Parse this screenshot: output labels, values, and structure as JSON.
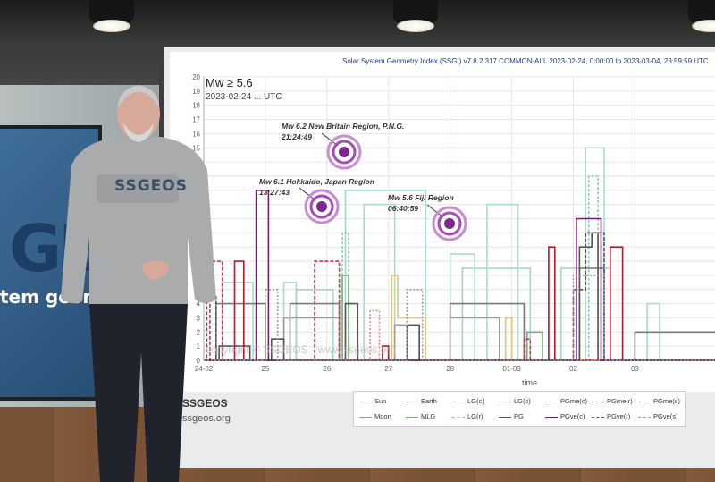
{
  "chart_data": {
    "type": "line",
    "title": "Solar System Geometry Index (SSGI) v7.8.2.317 COMMON-ALL 2023-02-24, 0:00:00 to 2023-03-04, 23:59:59 UTC",
    "subtitle": "Mw ≥ 5.6",
    "date_label": "2023-02-24 ... UTC",
    "xlabel": "time",
    "ylabel": "",
    "x_ticks": [
      "24-02",
      "25",
      "26",
      "27",
      "28",
      "01-03",
      "02",
      "03"
    ],
    "y_ticks": [
      0,
      1,
      2,
      3,
      4,
      5,
      6,
      7,
      8,
      9,
      10,
      11,
      12,
      13,
      14,
      15,
      16,
      17,
      18,
      19,
      20
    ],
    "ylim": [
      0,
      20
    ],
    "xlim": [
      0,
      8.3
    ],
    "grid": true,
    "series": [
      {
        "name": "LG(s)",
        "color": "#a9dccb",
        "dash": "",
        "x": [
          0,
          0.3,
          0.3,
          0.8,
          0.8,
          1.3,
          1.3,
          1.5,
          1.5,
          2.6,
          2.6,
          3.1,
          3.1,
          4.0,
          4.0,
          4.4,
          4.4,
          4.6,
          4.6,
          5.1,
          5.1,
          6.2,
          6.2,
          6.5,
          6.5,
          7.2,
          7.2,
          7.4,
          7.4,
          8.3
        ],
        "y": [
          0,
          0,
          5.5,
          5.5,
          0,
          0,
          5.5,
          5.5,
          0,
          0,
          11,
          11,
          0,
          0,
          7.5,
          7.5,
          0,
          0,
          11,
          11,
          0,
          0,
          15,
          15,
          0,
          0,
          4,
          4,
          0,
          0
        ]
      },
      {
        "name": "LG(c)",
        "color": "#9fd6c4",
        "dash": "",
        "x": [
          0,
          1.5,
          1.5,
          2.1,
          2.1,
          2.3,
          2.3,
          3.6,
          3.6,
          4.2,
          4.2,
          5.3,
          5.3,
          5.8,
          5.8,
          6.6,
          6.6,
          8.3
        ],
        "y": [
          0,
          0,
          5,
          5,
          0,
          0,
          12,
          12,
          0,
          0,
          6.5,
          6.5,
          0,
          0,
          6.5,
          6.5,
          0,
          0
        ]
      },
      {
        "name": "LG(r)",
        "color": "#8cc9b5",
        "dash": "3,2",
        "x": [
          0,
          2.25,
          2.25,
          2.35,
          2.35,
          6.25,
          6.25,
          6.4,
          6.4,
          8.3
        ],
        "y": [
          0,
          0,
          9,
          9,
          0,
          0,
          13,
          13,
          0,
          0
        ]
      },
      {
        "name": "Sun",
        "color": "#e3c46c",
        "dash": "",
        "x": [
          0,
          3.05,
          3.05,
          3.15,
          3.15,
          3.6,
          3.6,
          4.9,
          4.9,
          5.0,
          5.0,
          8.3
        ],
        "y": [
          0,
          0,
          6,
          6,
          3,
          3,
          0,
          0,
          3,
          3,
          0,
          0
        ]
      },
      {
        "name": "Earth",
        "color": "#7a7a7a",
        "dash": "",
        "x": [
          0,
          0.2,
          0.2,
          1.0,
          1.0,
          1.4,
          1.4,
          2.2,
          2.2,
          4.0,
          4.0,
          5.2,
          5.2,
          6.1,
          6.1,
          6.5,
          6.5,
          7.0,
          7.0,
          8.3
        ],
        "y": [
          0,
          0,
          4,
          4,
          0,
          0,
          4,
          4,
          0,
          0,
          4,
          4,
          0,
          0,
          6.5,
          6.5,
          0,
          0,
          2,
          2
        ]
      },
      {
        "name": "Moon",
        "color": "#9a9a9a",
        "dash": "",
        "x": [
          0,
          1.3,
          1.3,
          2.2,
          2.2,
          3.1,
          3.1,
          3.5,
          3.5,
          4.0,
          4.0,
          4.8,
          4.8,
          8.3
        ],
        "y": [
          0,
          0,
          3,
          3,
          0,
          0,
          2.5,
          2.5,
          0,
          0,
          3,
          3,
          0,
          0
        ]
      },
      {
        "name": "MLG",
        "color": "#77b27a",
        "dash": "",
        "x": [
          0,
          2.25,
          2.25,
          2.35,
          2.35,
          5.25,
          5.25,
          5.5,
          5.5,
          8.3
        ],
        "y": [
          0,
          0,
          6,
          6,
          0,
          0,
          2,
          2,
          0,
          0
        ]
      },
      {
        "name": "PG",
        "color": "#555555",
        "dash": "",
        "x": [
          0,
          0.25,
          0.25,
          0.75,
          0.75,
          1.1,
          1.1,
          1.3,
          1.3,
          2.3,
          2.3,
          2.5,
          2.5,
          3.3,
          3.3,
          3.5,
          3.5,
          6.1,
          6.1,
          6.3,
          6.3,
          6.4,
          6.4,
          8.3
        ],
        "y": [
          0,
          0,
          1,
          1,
          0,
          0,
          1.5,
          1.5,
          0,
          0,
          4,
          4,
          0,
          0,
          2.5,
          2.5,
          0,
          0,
          8,
          8,
          9,
          9,
          0,
          0
        ]
      },
      {
        "name": "PGme(c)",
        "color": "#b8182c",
        "dash": "",
        "x": [
          0,
          0.5,
          0.5,
          0.65,
          0.65,
          2.9,
          2.9,
          3.0,
          3.0,
          5.6,
          5.6,
          5.7,
          5.7,
          6.6,
          6.6,
          6.8,
          6.8,
          8.3
        ],
        "y": [
          0,
          0,
          7,
          7,
          0,
          0,
          1,
          1,
          0,
          0,
          8,
          8,
          0,
          0,
          8,
          8,
          0,
          0
        ]
      },
      {
        "name": "PGme(r)",
        "color": "#c73a4a",
        "dash": "4,2",
        "x": [
          0,
          0.1,
          0.1,
          0.3,
          0.3,
          1.8,
          1.8,
          2.2,
          2.2,
          5.2,
          5.2,
          5.3,
          5.3,
          8.3
        ],
        "y": [
          0,
          0,
          7,
          7,
          0,
          0,
          7,
          7,
          0,
          0,
          1.5,
          1.5,
          0,
          0
        ]
      },
      {
        "name": "PGme(s)",
        "color": "#e08a8a",
        "dash": "2,2",
        "x": [
          0,
          2.7,
          2.7,
          2.85,
          2.85,
          8.3
        ],
        "y": [
          0,
          0,
          3.5,
          3.5,
          0,
          0
        ]
      },
      {
        "name": "PGve(c)",
        "color": "#6f1e6b",
        "dash": "",
        "x": [
          0,
          0.85,
          0.85,
          1.05,
          1.05,
          6.05,
          6.05,
          6.45,
          6.45,
          8.3
        ],
        "y": [
          0,
          0,
          12,
          12,
          0,
          0,
          10,
          10,
          0,
          0
        ]
      },
      {
        "name": "PGve(r)",
        "color": "#555555",
        "dash": "4,2",
        "x": [
          0,
          0.05,
          0.05,
          0.2,
          0.2,
          6.0,
          6.0,
          6.2,
          6.2,
          6.5,
          6.5,
          8.3
        ],
        "y": [
          0,
          0,
          4.5,
          4.5,
          0,
          0,
          5,
          5,
          9,
          9,
          0,
          0
        ]
      },
      {
        "name": "PGve(s)",
        "color": "#999999",
        "dash": "2,2",
        "x": [
          0,
          1.0,
          1.0,
          1.2,
          1.2,
          3.3,
          3.3,
          3.55,
          3.55,
          6.0,
          6.0,
          6.5,
          6.5,
          8.3
        ],
        "y": [
          0,
          0,
          5,
          5,
          0,
          0,
          5,
          5,
          0,
          0,
          6,
          6,
          0,
          0
        ]
      }
    ],
    "annotations": [
      {
        "label": "Mw 6.2 New Britain Region, P.N.G.",
        "time": "21:24:49"
      },
      {
        "label": "Mw 6.1 Hokkaido, Japan Region",
        "time": "13:27:43"
      },
      {
        "label": "Mw 5.6 Fiji Region",
        "time": "06:40:59"
      }
    ],
    "legend_position": "bottom"
  },
  "studio": {
    "copyright": "copyright © SSGEOS - www.ssgeos.org",
    "brand_name": "SSGEOS",
    "brand_url": "ssgeos.org",
    "hoodie_text": "SSGEOS",
    "tv_text_big": "GL",
    "tv_text_small": "tem geome"
  },
  "colors": {
    "target_icon": "#9b3aa8",
    "axis": "#cccccc"
  }
}
